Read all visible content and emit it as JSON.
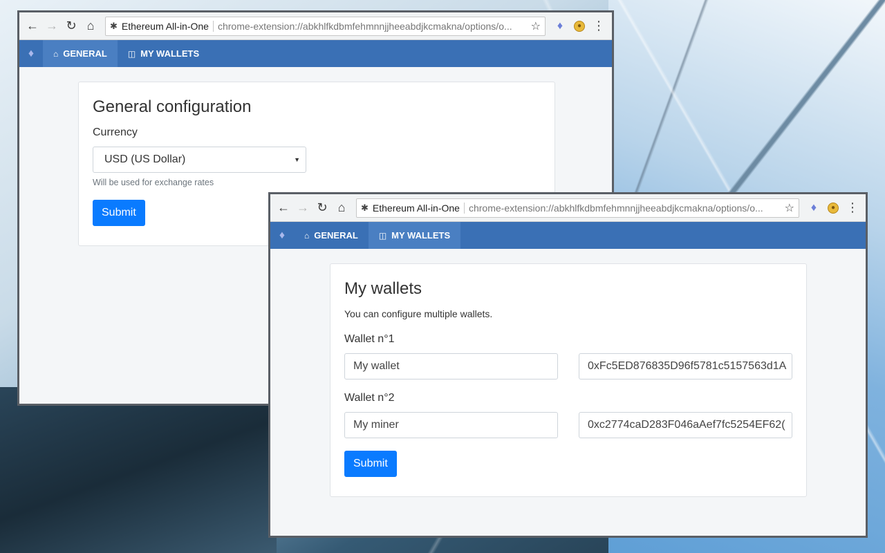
{
  "browser": {
    "tab_title": "Ethereum All-in-One",
    "url": "chrome-extension://abkhlfkdbmfehmnnjjheeabdjkcmakna/options/o..."
  },
  "icons": {
    "back": "arrow-left-icon",
    "forward": "arrow-right-icon",
    "reload": "reload-icon",
    "home": "home-icon",
    "star": "star-icon",
    "extension": "puzzle-icon",
    "ethereum": "ethereum-icon",
    "coin": "coin-icon",
    "menu": "kebab-menu-icon",
    "wallet": "money-icon"
  },
  "colors": {
    "nav_bar": "#3a70b5",
    "nav_active": "#4a7fc2",
    "primary_button": "#0a7bff"
  },
  "nav": {
    "general_label": "GENERAL",
    "wallets_label": "MY WALLETS"
  },
  "general": {
    "title": "General configuration",
    "currency_label": "Currency",
    "currency_value": "USD (US Dollar)",
    "currency_help": "Will be used for exchange rates",
    "submit_label": "Submit"
  },
  "wallets": {
    "title": "My wallets",
    "intro": "You can configure multiple wallets.",
    "items": [
      {
        "label": "Wallet n°1",
        "name": "My wallet",
        "address": "0xFc5ED876835D96f5781c5157563d1A"
      },
      {
        "label": "Wallet n°2",
        "name": "My miner",
        "address": "0xc2774caD283F046aAef7fc5254EF62("
      }
    ],
    "submit_label": "Submit"
  }
}
